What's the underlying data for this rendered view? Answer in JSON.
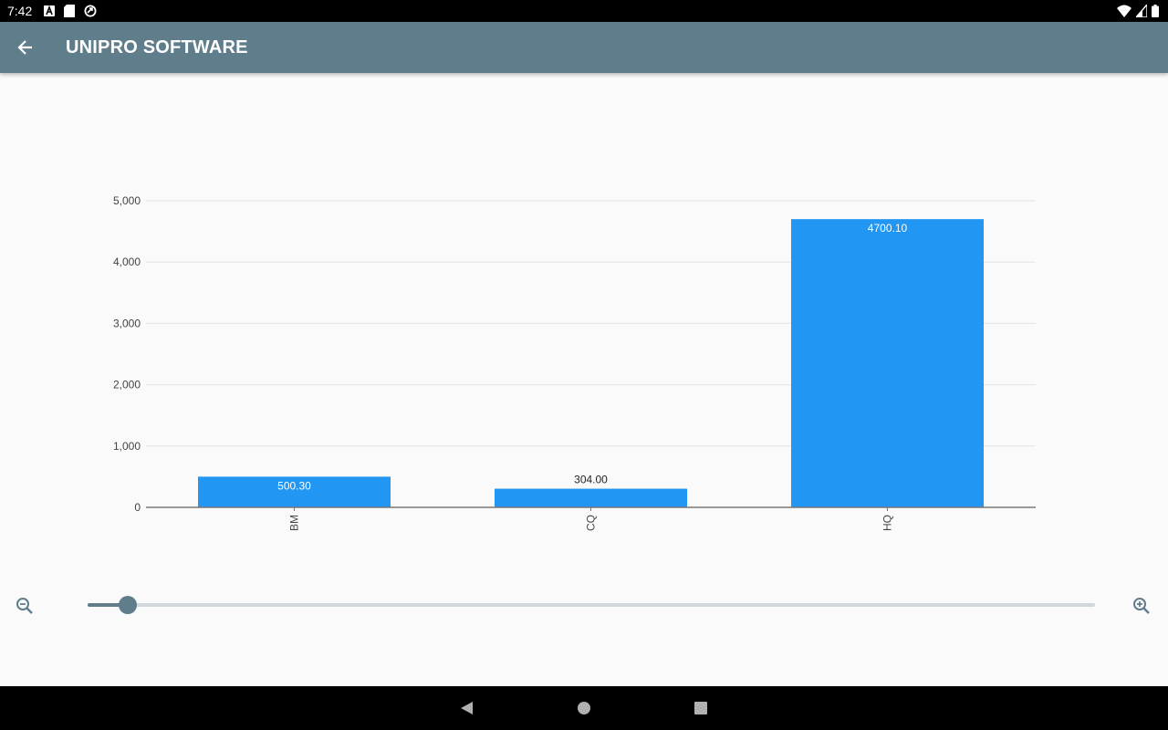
{
  "status_bar": {
    "time": "7:42",
    "left_icons": [
      "a-notification-icon",
      "sd-card-icon",
      "sync-icon"
    ],
    "right_icons": [
      "wifi-icon",
      "signal-icon",
      "battery-icon"
    ]
  },
  "app_bar": {
    "title": "UNIPRO SOFTWARE",
    "background": "#607d8b"
  },
  "chart_data": {
    "type": "bar",
    "categories": [
      "BM",
      "CQ",
      "HQ"
    ],
    "values": [
      500.3,
      304.0,
      4700.1
    ],
    "value_labels": [
      "500.30",
      "304.00",
      "4700.10"
    ],
    "ylim": [
      0,
      5000
    ],
    "yticks": [
      "0",
      "1,000",
      "2,000",
      "3,000",
      "4,000",
      "5,000"
    ],
    "ytick_values": [
      0,
      1000,
      2000,
      3000,
      4000,
      5000
    ],
    "bar_color": "#2196f3",
    "grid": true,
    "title": "",
    "xlabel": "",
    "ylabel": ""
  },
  "zoom": {
    "level": 0.04,
    "out_icon": "zoom-out-icon",
    "in_icon": "zoom-in-icon"
  },
  "nav_bar": {
    "buttons": [
      "back-triangle-icon",
      "home-circle-icon",
      "recents-square-icon"
    ]
  }
}
